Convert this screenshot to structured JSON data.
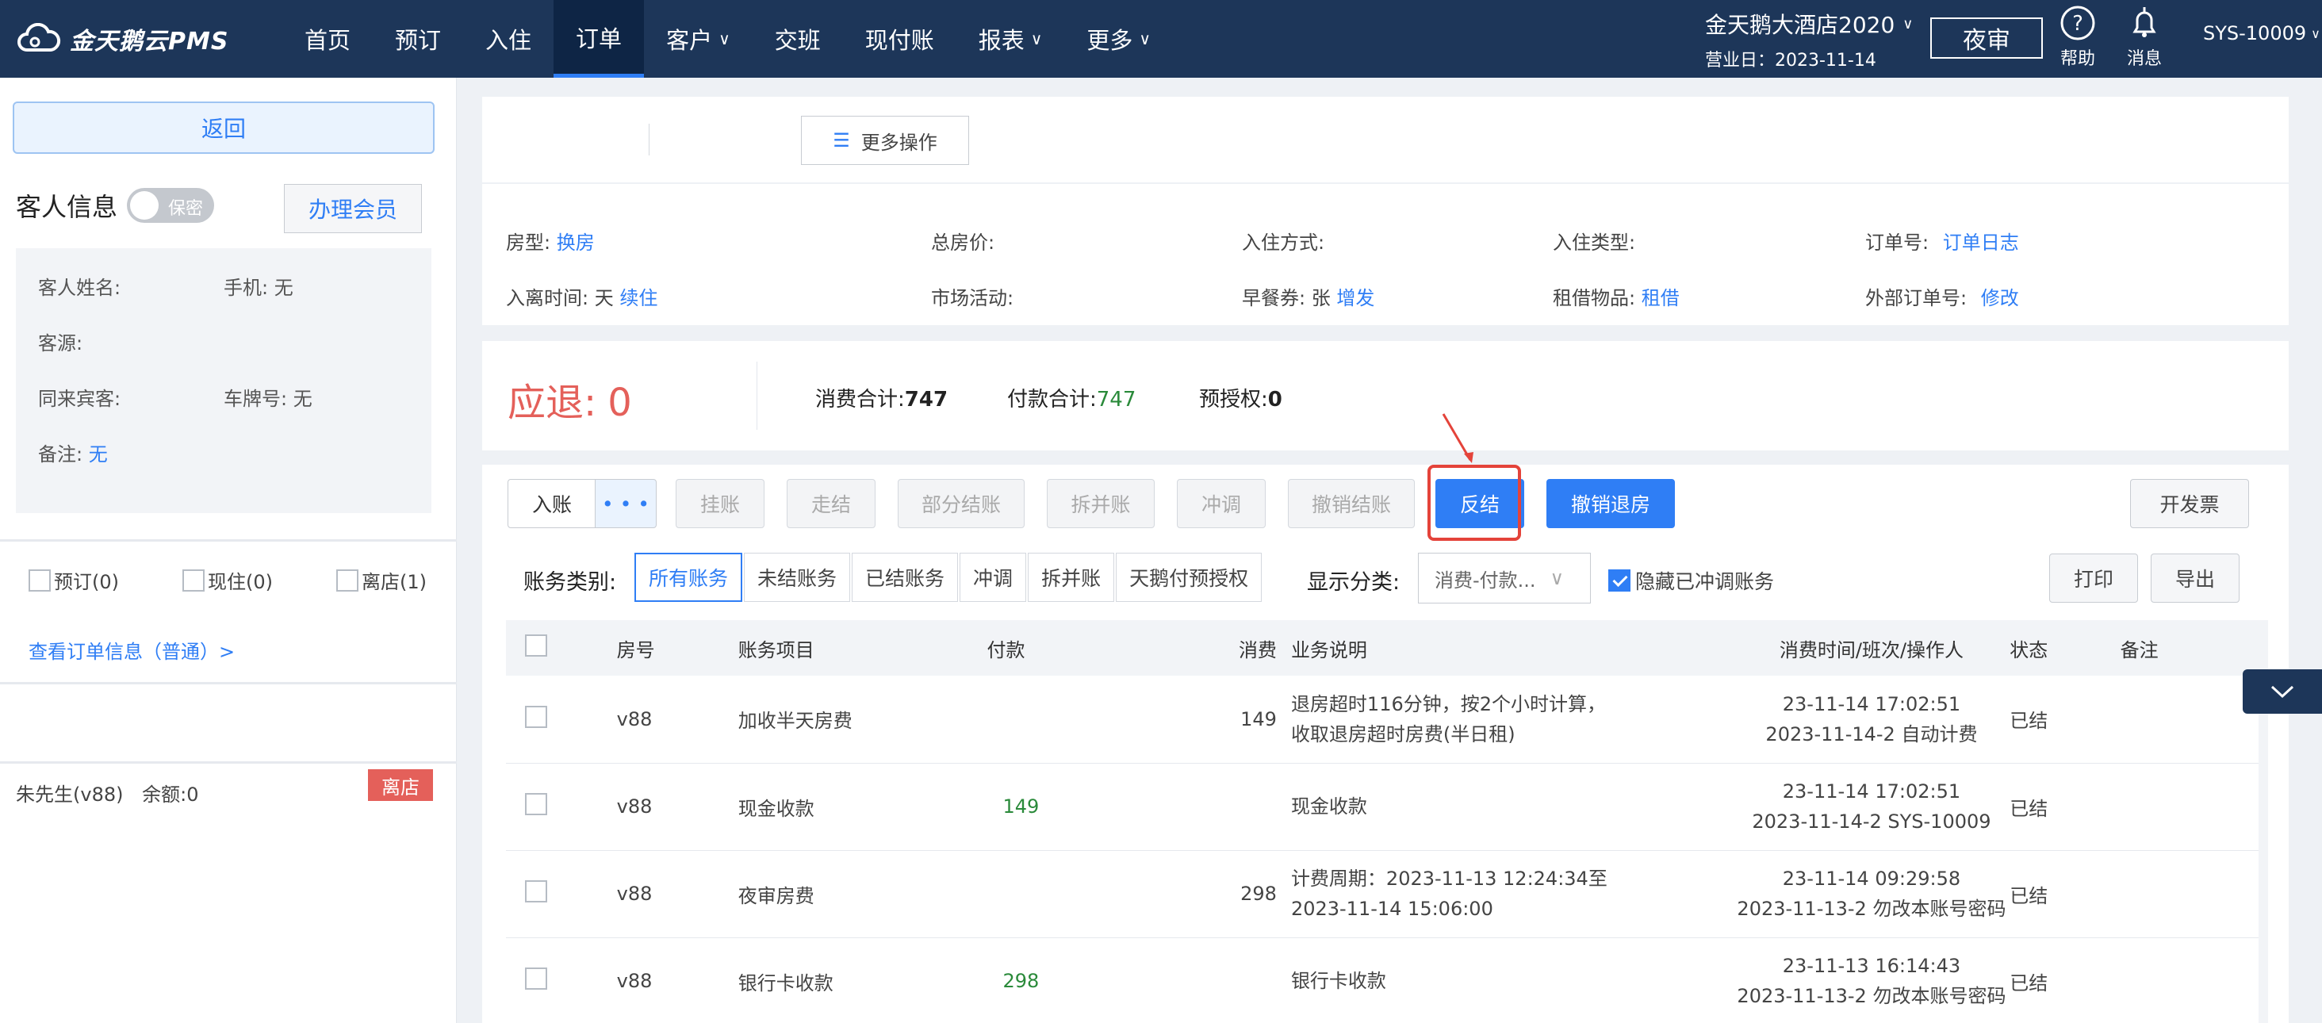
{
  "brand": {
    "name": "金天鹅云PMS"
  },
  "nav": {
    "items": [
      {
        "label": "首页",
        "active": false,
        "dropdown": false
      },
      {
        "label": "预订",
        "active": false,
        "dropdown": false
      },
      {
        "label": "入住",
        "active": false,
        "dropdown": false
      },
      {
        "label": "订单",
        "active": true,
        "dropdown": false
      },
      {
        "label": "客户",
        "active": false,
        "dropdown": true
      },
      {
        "label": "交班",
        "active": false,
        "dropdown": false
      },
      {
        "label": "现付账",
        "active": false,
        "dropdown": false
      },
      {
        "label": "报表",
        "active": false,
        "dropdown": true
      },
      {
        "label": "更多",
        "active": false,
        "dropdown": true
      }
    ],
    "hotel_name": "金天鹅大酒店2020",
    "business_date": "营业日：2023-11-14",
    "night_audit": "夜审",
    "help": "帮助",
    "messages": "消息",
    "user": "SYS-10009"
  },
  "sidebar": {
    "back": "返回",
    "guest_info_title": "客人信息",
    "privacy_toggle": "保密",
    "member_button": "办理会员",
    "guest": {
      "name_label": "客人姓名:",
      "phone": "手机: 无",
      "source_label": "客源:",
      "companions_label": "同来宾客:",
      "plate": "车牌号: 无",
      "remark_label": "备注:",
      "remark_value": "无"
    },
    "status_filters": [
      "预订(0)",
      "现住(0)",
      "离店(1)"
    ],
    "order_link": "查看订单信息（普通）>",
    "guest_row": {
      "name": "朱先生(v88)",
      "balance": "余额:0",
      "tag": "离店"
    }
  },
  "order": {
    "more_ops": "更多操作",
    "room_type_label": "房型:",
    "room_type_action": "换房",
    "total_price_label": "总房价:",
    "checkin_mode_label": "入住方式:",
    "checkin_type_label": "入住类型:",
    "order_no_label": "订单号:",
    "order_log": "订单日志",
    "stay_label": "入离时间:",
    "stay_unit": "天",
    "extend": "续住",
    "market_label": "市场活动:",
    "breakfast_label": "早餐券:",
    "breakfast_unit": "张",
    "breakfast_action": "增发",
    "rental_label": "租借物品:",
    "rental_action": "租借",
    "external_no_label": "外部订单号:",
    "external_action": "修改"
  },
  "summary": {
    "refund_label": "应退:",
    "refund_value": "0",
    "consumption_label": "消费合计:",
    "consumption_value": "747",
    "payment_label": "付款合计:",
    "payment_value": "747",
    "preauth_label": "预授权:",
    "preauth_value": "0"
  },
  "actions": {
    "post": "入账",
    "more_dots": "• • •",
    "hang": "挂账",
    "walk": "走结",
    "partial": "部分结账",
    "split": "拆并账",
    "adjust": "冲调",
    "cancel_settle": "撤销结账",
    "reverse": "反结",
    "cancel_checkout": "撤销退房",
    "invoice": "开发票"
  },
  "filters": {
    "category_label": "账务类别:",
    "tabs": [
      "所有账务",
      "未结账务",
      "已结账务",
      "冲调",
      "拆并账",
      "天鹅付预授权"
    ],
    "display_label": "显示分类:",
    "display_value": "消费-付款...",
    "hide_adjusted": "隐藏已冲调账务",
    "print": "打印",
    "export": "导出"
  },
  "table": {
    "headers": [
      "房号",
      "账务项目",
      "付款",
      "消费",
      "业务说明",
      "消费时间/班次/操作人",
      "状态",
      "备注"
    ],
    "rows": [
      {
        "room": "v88",
        "item": "加收半天房费",
        "payment": "",
        "consumption": "149",
        "desc1": "退房超时116分钟，按2个小时计算，",
        "desc2": "收取退房超时房费(半日租)",
        "time1": "23-11-14 17:02:51",
        "time2": "2023-11-14-2 自动计费",
        "status": "已结",
        "remark": ""
      },
      {
        "room": "v88",
        "item": "现金收款",
        "payment": "149",
        "consumption": "",
        "desc1": "现金收款",
        "desc2": "",
        "time1": "23-11-14 17:02:51",
        "time2": "2023-11-14-2 SYS-10009",
        "status": "已结",
        "remark": ""
      },
      {
        "room": "v88",
        "item": "夜审房费",
        "payment": "",
        "consumption": "298",
        "desc1": "计费周期：2023-11-13 12:24:34至",
        "desc2": "2023-11-14 15:06:00",
        "time1": "23-11-14 09:29:58",
        "time2": "2023-11-13-2 勿改本账号密码",
        "status": "已结",
        "remark": ""
      },
      {
        "room": "v88",
        "item": "银行卡收款",
        "payment": "298",
        "consumption": "",
        "desc1": "银行卡收款",
        "desc2": "",
        "time1": "23-11-13 16:14:43",
        "time2": "2023-11-13-2 勿改本账号密码",
        "status": "已结",
        "remark": ""
      }
    ]
  },
  "colors": {
    "accent": "#2f7ef5",
    "nav_bg": "#1d3659",
    "refund": "#e4605a",
    "payment_green": "#2a8a3a",
    "highlight": "#e4433a"
  }
}
